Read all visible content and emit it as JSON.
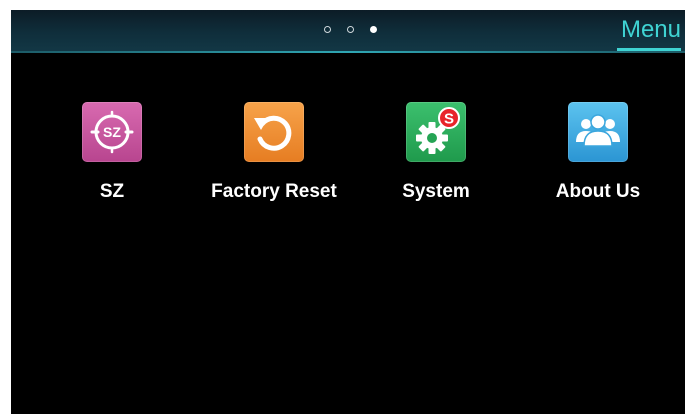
{
  "header": {
    "title": "Menu",
    "page_count": 3,
    "active_page": 3
  },
  "apps": [
    {
      "label": "SZ",
      "icon": "sz-icon",
      "icon_text": "SZ",
      "color": "#c9559f"
    },
    {
      "label": "Factory Reset",
      "icon": "factory-reset-icon",
      "color": "#ef8f35"
    },
    {
      "label": "System",
      "icon": "system-gear-icon",
      "badge": "S",
      "color": "#2eae5d"
    },
    {
      "label": "About Us",
      "icon": "about-us-people-icon",
      "color": "#3fabe0"
    }
  ],
  "colors": {
    "accent": "#3fd3d3",
    "background": "#000000"
  }
}
